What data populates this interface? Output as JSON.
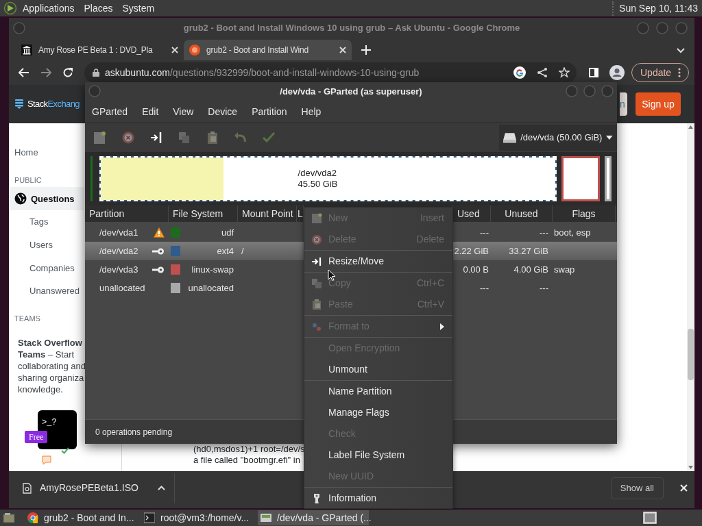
{
  "top_panel": {
    "menus": [
      "Applications",
      "Places",
      "System"
    ],
    "clock": "Sun Sep 10, 11:43"
  },
  "browser": {
    "title": "grub2 - Boot and Install Windows 10 using grub – Ask Ubuntu - Google Chrome",
    "tabs": [
      {
        "label": "Amy Rose PE Beta 1 : DVD_Pla",
        "selected": false
      },
      {
        "label": "grub2 - Boot and Install Wind",
        "selected": true
      }
    ],
    "address": {
      "host": "askubuntu.com",
      "path": "/questions/932999/boot-and-install-windows-10-using-grub"
    },
    "update_button": "Update",
    "page": {
      "logo": {
        "first": "Stack",
        "second": "Exchang"
      },
      "login_button": "n",
      "signup_button": "Sign up",
      "nav": [
        {
          "kind": "link",
          "label": "Home",
          "selected": false
        },
        {
          "kind": "heading",
          "label": "PUBLIC"
        },
        {
          "kind": "link",
          "label": "Questions",
          "selected": true
        },
        {
          "kind": "sublink",
          "label": "Tags",
          "selected": false
        },
        {
          "kind": "sublink",
          "label": "Users",
          "selected": false
        },
        {
          "kind": "sublink",
          "label": "Companies",
          "selected": false
        },
        {
          "kind": "sublink",
          "label": "Unanswered",
          "selected": false
        },
        {
          "kind": "heading",
          "label": "TEAMS"
        }
      ],
      "teams_promo": "**Stack Overflow**\n**Teams** – Start\ncollaborating and\nsharing organiza\nknowledge.",
      "teams_art": {
        "prompt": ">_?",
        "badge": "Free"
      },
      "snippet_lines": [
        "(hd0,msdos1)+1 root=/dev/s",
        "a file called \"bootmgr.efi\" in"
      ]
    },
    "downloads": {
      "file": "AmyRosePEBeta1.ISO",
      "show_all": "Show all"
    }
  },
  "gparted": {
    "title": "/dev/vda - GParted (as superuser)",
    "menu": [
      "GParted",
      "Edit",
      "View",
      "Device",
      "Partition",
      "Help"
    ],
    "toolbar": [
      {
        "kind": "new",
        "disabled": true
      },
      {
        "kind": "delete",
        "disabled": true
      },
      {
        "kind": "resize",
        "disabled": false
      },
      {
        "kind": "copy",
        "disabled": true
      },
      {
        "kind": "paste",
        "disabled": true
      },
      {
        "kind": "undo",
        "disabled": true
      },
      {
        "kind": "apply",
        "disabled": true
      }
    ],
    "device": "/dev/vda (50.00 GiB)",
    "disk_map": [
      {
        "color": "#1d6b1d",
        "selected": false
      },
      {
        "color": "#2f5c8a",
        "selected": true,
        "label": "/dev/vda2",
        "size": "45.50 GiB",
        "level": 0.27
      },
      {
        "color": "#c0504d",
        "selected": false
      },
      {
        "color": "#a9a9a9",
        "selected": false
      }
    ],
    "columns": [
      "Partition",
      "File System",
      "Mount Point",
      "L",
      "Used",
      "Unused",
      "Flags"
    ],
    "rows": [
      {
        "partition": "/dev/vda1",
        "kind": "warning",
        "color": "#1d6b1d",
        "filesystem": "udf",
        "used": "---",
        "unused": "---",
        "flags": "boot, esp",
        "selected": false
      },
      {
        "partition": "/dev/vda2",
        "kind": "key",
        "color": "#2f5c8a",
        "filesystem": "ext4",
        "mount_point": "/",
        "used": "2.22 GiB",
        "unused": "33.27 GiB",
        "selected": true
      },
      {
        "partition": "/dev/vda3",
        "kind": "key",
        "color": "#c0504d",
        "filesystem": "linux-swap",
        "used": "0.00 B",
        "unused": "4.00 GiB",
        "flags": "swap",
        "selected": false
      },
      {
        "partition": "unallocated",
        "kind": "plain",
        "color": "#a9a9a9",
        "filesystem": "unallocated",
        "used": "---",
        "unused": "---",
        "selected": false
      }
    ],
    "status": "0 operations pending"
  },
  "context_menu": [
    {
      "kind": "new",
      "label": "New",
      "shortcut": "Insert",
      "disabled": true
    },
    {
      "kind": "delete",
      "label": "Delete",
      "shortcut": "Delete",
      "disabled": true
    },
    {
      "kind": "separator"
    },
    {
      "kind": "resize",
      "label": "Resize/Move",
      "disabled": false
    },
    {
      "kind": "separator"
    },
    {
      "kind": "copy",
      "label": "Copy",
      "shortcut": "Ctrl+C",
      "disabled": true
    },
    {
      "kind": "paste",
      "label": "Paste",
      "shortcut": "Ctrl+V",
      "disabled": true
    },
    {
      "kind": "separator"
    },
    {
      "kind": "format",
      "label": "Format to",
      "disabled": true
    },
    {
      "kind": "separator"
    },
    {
      "kind": "plain",
      "label": "Open Encryption",
      "disabled": true
    },
    {
      "kind": "plain",
      "label": "Unmount",
      "disabled": false
    },
    {
      "kind": "separator"
    },
    {
      "kind": "plain",
      "label": "Name Partition",
      "disabled": false
    },
    {
      "kind": "plain",
      "label": "Manage Flags",
      "disabled": false
    },
    {
      "kind": "plain",
      "label": "Check",
      "disabled": true
    },
    {
      "kind": "plain",
      "label": "Label File System",
      "disabled": false
    },
    {
      "kind": "plain",
      "label": "New UUID",
      "disabled": true
    },
    {
      "kind": "separator"
    },
    {
      "kind": "info",
      "label": "Information",
      "disabled": false
    }
  ],
  "taskbar": [
    {
      "label": "grub2 - Boot and In...",
      "selected": false
    },
    {
      "label": "root@vm3:/home/v...",
      "selected": false
    },
    {
      "label": "/dev/vda - GParted (...",
      "selected": true
    }
  ]
}
